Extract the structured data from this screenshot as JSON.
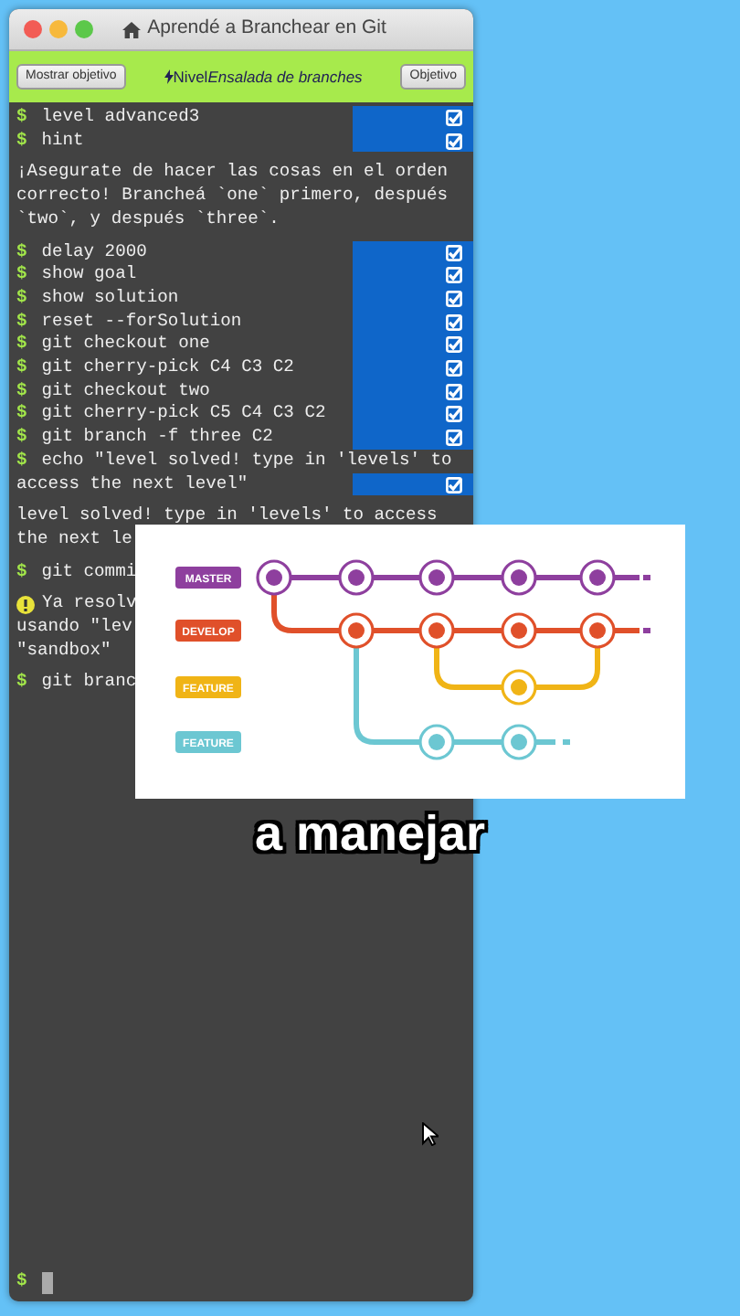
{
  "window": {
    "title": "Aprendé a Branchear en Git"
  },
  "toolbar": {
    "left_button": "Mostrar objetivo",
    "level_label": "Nivel",
    "level_name": "Ensalada de branches",
    "right_button": "Objetivo"
  },
  "terminal": {
    "entries": [
      {
        "kind": "command",
        "prompt": "$",
        "lines": [
          "level advanced3"
        ],
        "done": true
      },
      {
        "kind": "command",
        "prompt": "$",
        "lines": [
          "hint"
        ],
        "done": true
      },
      {
        "kind": "output",
        "lines": [
          "¡Asegurate de hacer las cosas en el orden",
          "correcto! Brancheá `one` primero, después",
          "`two`, y después `three`."
        ]
      },
      {
        "kind": "command",
        "prompt": "$",
        "lines": [
          "delay 2000"
        ],
        "done": true
      },
      {
        "kind": "command",
        "prompt": "$",
        "lines": [
          "show goal"
        ],
        "done": true
      },
      {
        "kind": "command",
        "prompt": "$",
        "lines": [
          "show solution"
        ],
        "done": true
      },
      {
        "kind": "command",
        "prompt": "$",
        "lines": [
          "reset --forSolution"
        ],
        "done": true
      },
      {
        "kind": "command",
        "prompt": "$",
        "lines": [
          "git checkout one"
        ],
        "done": true
      },
      {
        "kind": "command",
        "prompt": "$",
        "lines": [
          "git cherry-pick C4 C3 C2"
        ],
        "done": true
      },
      {
        "kind": "command",
        "prompt": "$",
        "lines": [
          "git checkout two"
        ],
        "done": true
      },
      {
        "kind": "command",
        "prompt": "$",
        "lines": [
          "git cherry-pick C5 C4 C3 C2"
        ],
        "done": true
      },
      {
        "kind": "command",
        "prompt": "$",
        "lines": [
          "git branch -f three C2"
        ],
        "done": true
      },
      {
        "kind": "command",
        "prompt": "$",
        "lines": [
          "echo \"level solved! type in 'levels' to",
          "access the next level\""
        ],
        "done": true
      },
      {
        "kind": "output",
        "lines": [
          "level solved! type in 'levels' to access",
          "the next le"
        ]
      },
      {
        "kind": "command",
        "prompt": "$",
        "lines": [
          "git commi"
        ]
      },
      {
        "kind": "warning",
        "lines": [
          "Ya resolv",
          "usando \"lev",
          "\"sandbox\""
        ]
      },
      {
        "kind": "command",
        "prompt": "$",
        "lines": [
          "git branc"
        ]
      }
    ],
    "input": {
      "prompt": "$"
    }
  },
  "diagram": {
    "tags": [
      {
        "label": "MASTER",
        "color": "#8e3f9e"
      },
      {
        "label": "DEVELOP",
        "color": "#e0502a"
      },
      {
        "label": "FEATURE",
        "color": "#f0b416"
      },
      {
        "label": "FEATURE",
        "color": "#6cc7d2"
      }
    ]
  },
  "caption": "a manejar"
}
